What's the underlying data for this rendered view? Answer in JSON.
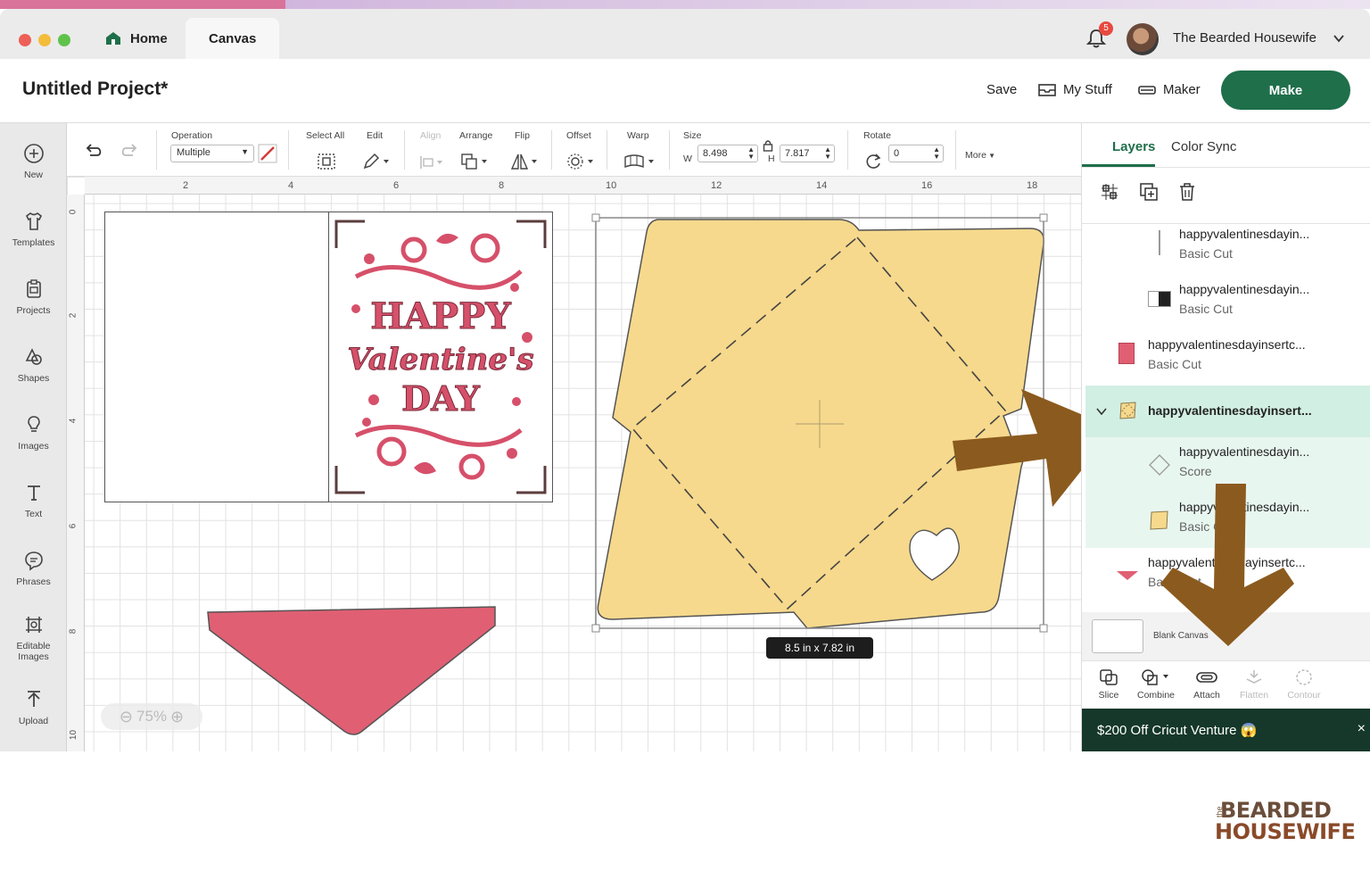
{
  "window": {
    "tabs": [
      {
        "label": "Home"
      },
      {
        "label": "Canvas"
      }
    ],
    "notification_count": "5",
    "user_name": "The Bearded Housewife"
  },
  "header": {
    "project_title": "Untitled Project*",
    "save_label": "Save",
    "mystuff_label": "My Stuff",
    "maker_label": "Maker",
    "make_label": "Make"
  },
  "sidebar": {
    "items": [
      {
        "label": "New",
        "icon": "plus-circle-icon"
      },
      {
        "label": "Templates",
        "icon": "shirt-icon"
      },
      {
        "label": "Projects",
        "icon": "clipboard-icon"
      },
      {
        "label": "Shapes",
        "icon": "shapes-icon"
      },
      {
        "label": "Images",
        "icon": "lightbulb-icon"
      },
      {
        "label": "Text",
        "icon": "text-icon"
      },
      {
        "label": "Phrases",
        "icon": "speech-bubble-icon"
      },
      {
        "label": "Editable Images",
        "icon": "editable-images-icon"
      },
      {
        "label": "Upload",
        "icon": "upload-icon"
      }
    ]
  },
  "toolbar": {
    "operation_label": "Operation",
    "operation_value": "Multiple",
    "select_all_label": "Select All",
    "edit_label": "Edit",
    "align_label": "Align",
    "arrange_label": "Arrange",
    "flip_label": "Flip",
    "offset_label": "Offset",
    "warp_label": "Warp",
    "size_label": "Size",
    "w_label": "W",
    "w_value": "8.498",
    "h_label": "H",
    "h_value": "7.817",
    "rotate_label": "Rotate",
    "rotate_value": "0",
    "more_label": "More"
  },
  "canvas": {
    "ruler_top": [
      "2",
      "4",
      "6",
      "8",
      "10",
      "12",
      "14",
      "16",
      "18"
    ],
    "ruler_left": [
      "0",
      "2",
      "4",
      "6",
      "8",
      "10"
    ],
    "card_text": {
      "line1": "HAPPY",
      "line2": "Valentine's",
      "line3": "DAY"
    },
    "zoom_label": "75%",
    "dimension_label": "8.5  in x 7.82  in",
    "colors": {
      "envelope": "#f6d98c",
      "pink": "#e05f73",
      "card_pink": "#d6506a",
      "arrow": "#8b5a1e"
    }
  },
  "panel": {
    "tabs": [
      {
        "label": "Layers"
      },
      {
        "label": "Color Sync"
      }
    ],
    "layers": [
      {
        "name": "happyvalentinesdayin...",
        "type": "Basic Cut"
      },
      {
        "name": "happyvalentinesdayin...",
        "type": "Basic Cut"
      },
      {
        "name": "happyvalentinesdayinsertc...",
        "type": "Basic Cut"
      },
      {
        "name": "happyvalentinesdayinsert...",
        "type": ""
      },
      {
        "name": "happyvalentinesdayin...",
        "type": "Score"
      },
      {
        "name": "happyvalentinesdayin...",
        "type": "Basic Cut"
      },
      {
        "name": "happyvalentinesdayinsertc...",
        "type": "Basic Cut"
      }
    ],
    "blank_canvas_label": "Blank Canvas",
    "actions": [
      {
        "label": "Slice"
      },
      {
        "label": "Combine"
      },
      {
        "label": "Attach"
      },
      {
        "label": "Flatten"
      },
      {
        "label": "Contour"
      }
    ],
    "promo_text": "$200 Off Cricut Venture 😱",
    "promo_close": "×"
  },
  "logo": {
    "the": "the",
    "line1": "BEARDED",
    "line2": "HOUSEWIFE"
  }
}
